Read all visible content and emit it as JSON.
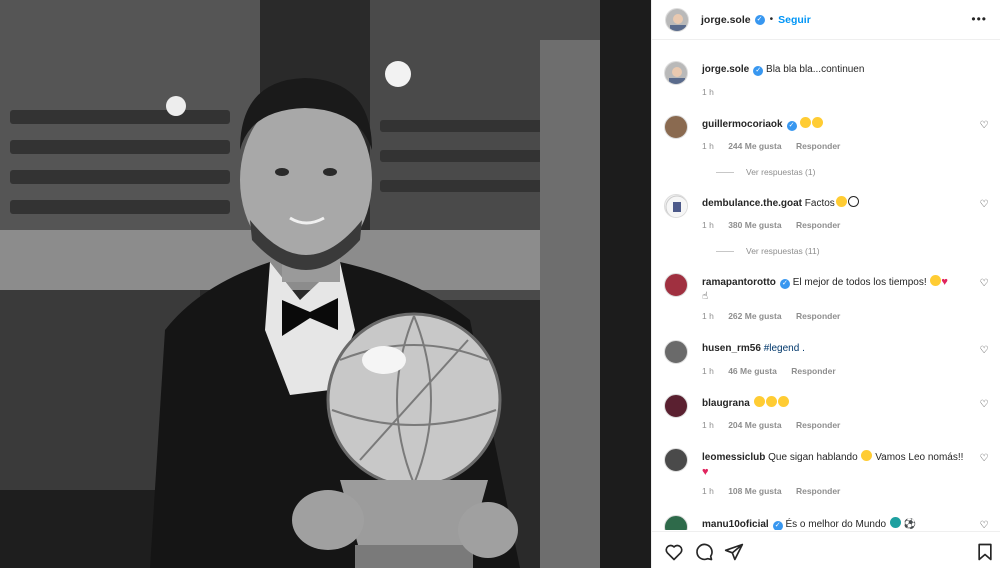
{
  "post": {
    "author": "jorge.sole",
    "follow_label": "Seguir",
    "more_label": "•••",
    "caption": {
      "username": "jorge.sole",
      "text": "Bla bla bla...continuen",
      "time": "1 h"
    }
  },
  "comments": [
    {
      "username": "guillermocoriaok",
      "verified": true,
      "text": "",
      "time": "1 h",
      "likes": "244 Me gusta",
      "reply_label": "Responder",
      "view_replies": "Ver respuestas (1)"
    },
    {
      "username": "dembulance.the.goat",
      "verified": false,
      "text": "Factos",
      "time": "1 h",
      "likes": "380 Me gusta",
      "reply_label": "Responder",
      "view_replies": "Ver respuestas (11)"
    },
    {
      "username": "ramapantorotto",
      "verified": true,
      "text": "El mejor de todos los tiempos!",
      "time": "1 h",
      "likes": "262 Me gusta",
      "reply_label": "Responder"
    },
    {
      "username": "husen_rm56",
      "verified": false,
      "text": "#legend .",
      "time": "1 h",
      "likes": "46 Me gusta",
      "reply_label": "Responder"
    },
    {
      "username": "blaugrana",
      "verified": false,
      "text": "",
      "time": "1 h",
      "likes": "204 Me gusta",
      "reply_label": "Responder"
    },
    {
      "username": "leomessiclub",
      "verified": false,
      "text": "Que sigan hablando",
      "text2": "Vamos Leo nomás!!",
      "time": "1 h",
      "likes": "108 Me gusta",
      "reply_label": "Responder"
    },
    {
      "username": "manu10oficial",
      "verified": true,
      "text": "És o melhor do Mundo"
    }
  ],
  "icons": {
    "heart": "heart-icon",
    "comment": "comment-icon",
    "share": "share-icon",
    "bookmark": "bookmark-icon",
    "verified": "verified-icon"
  },
  "colors": {
    "accent": "#0095f6",
    "verified": "#3897f0",
    "muted": "#8e8e8e",
    "heart_red": "#e0245e"
  }
}
